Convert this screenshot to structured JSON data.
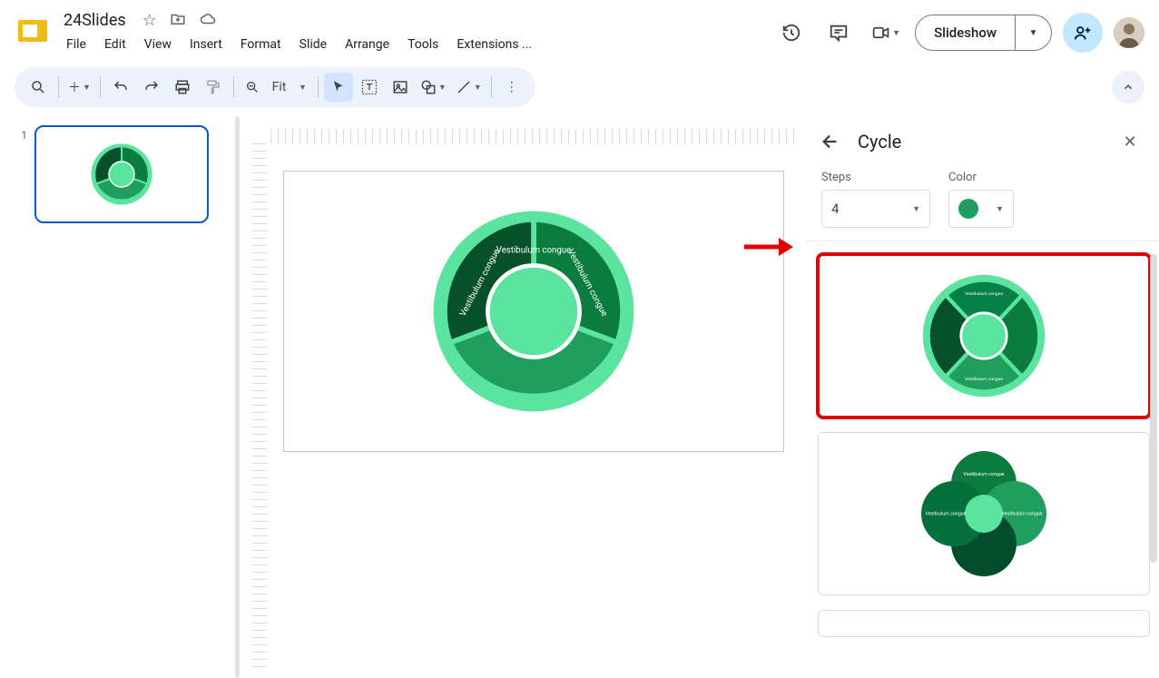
{
  "doc": {
    "title": "24Slides"
  },
  "menubar": {
    "file": "File",
    "edit": "Edit",
    "view": "View",
    "insert": "Insert",
    "format": "Format",
    "slide": "Slide",
    "arrange": "Arrange",
    "tools": "Tools",
    "extensions": "Extensions ..."
  },
  "header": {
    "slideshow": "Slideshow"
  },
  "toolbar": {
    "zoom_label": "Fit"
  },
  "filmstrip": {
    "slide1_num": "1"
  },
  "sidepanel": {
    "title": "Cycle",
    "steps_label": "Steps",
    "steps_value": "4",
    "color_label": "Color"
  },
  "diagram": {
    "segment_label": "Vestibulum congue"
  }
}
